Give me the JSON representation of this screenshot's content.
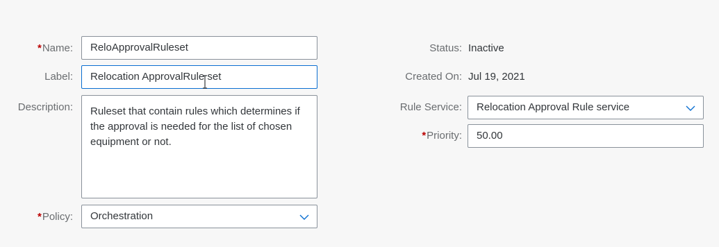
{
  "left": {
    "name": {
      "label": "Name:",
      "required_mark": "*",
      "value": "ReloApprovalRuleset"
    },
    "label_field": {
      "label": "Label:",
      "value": "Relocation ApprovalRule set"
    },
    "description": {
      "label": "Description:",
      "value": "Ruleset that contain rules which determines if the approval is needed for the list of chosen equipment or not."
    },
    "policy": {
      "label": "Policy:",
      "required_mark": "*",
      "value": "Orchestration",
      "icon": "chevron-down-icon"
    }
  },
  "right": {
    "status": {
      "label": "Status:",
      "value": "Inactive"
    },
    "created_on": {
      "label": "Created On:",
      "value": "Jul 19, 2021"
    },
    "rule_service": {
      "label": "Rule Service:",
      "value": "Relocation Approval Rule service",
      "icon": "chevron-down-icon"
    },
    "priority": {
      "label": "Priority:",
      "required_mark": "*",
      "value": "50.00"
    }
  },
  "colors": {
    "required": "#bb0000",
    "focus_border": "#0a6ed1",
    "chevron": "#0a6ed1"
  }
}
